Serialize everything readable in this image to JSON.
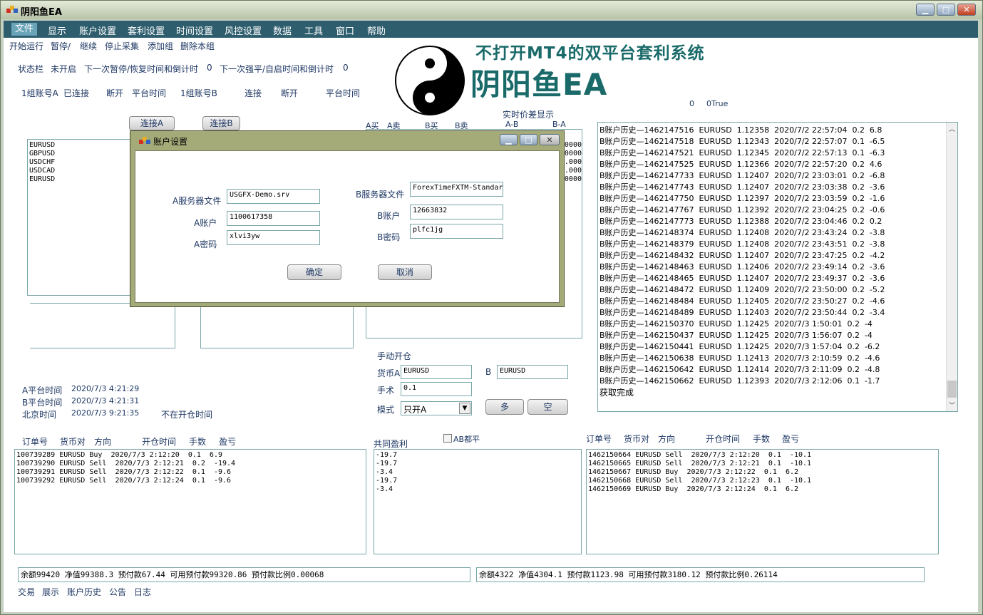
{
  "window": {
    "title": "阴阳鱼EA",
    "min": "▁",
    "max": "□",
    "close": "✕"
  },
  "menu": [
    "文件",
    "显示",
    "账户设置",
    "套利设置",
    "时间设置",
    "风控设置",
    "数据",
    "工具",
    "窗口",
    "帮助"
  ],
  "toolbar": [
    "开始运行",
    "暂停/",
    "继续",
    "停止采集",
    "添加组",
    "删除本组"
  ],
  "status_line": [
    "状态栏",
    "未开启",
    "下一次暂停/恢复时间和倒计时",
    "0",
    "下一次强平/自启时间和倒计时",
    "0"
  ],
  "group_line": [
    "1组账号A",
    "已连接",
    "断开",
    "平台时间",
    "1组账号B",
    "连接",
    "断开",
    "平台时间"
  ],
  "banner": {
    "line1": "不打开MT4的双平台套利系统",
    "line2": "阴阳鱼EA"
  },
  "top_right_status": [
    "0",
    "0True"
  ],
  "connect_a": "连接A",
  "connect_b": "连接B",
  "price_panel": {
    "title": "实时价差显示",
    "headers": [
      "A买",
      "A卖",
      "B买",
      "B卖",
      "A-B",
      "B-A"
    ],
    "values": [
      "0000",
      ".0000",
      ".000",
      ".000",
      "0000",
      "0000"
    ]
  },
  "symbols": [
    "EURUSD",
    "GBPUSD",
    "USDCHF",
    "USDCAD",
    "EURUSD"
  ],
  "history": [
    "B账户历史—1462147516  EURUSD  1.12358  2020/7/2 22:57:04  0.2  6.8",
    "B账户历史—1462147518  EURUSD  1.12343  2020/7/2 22:57:07  0.1  -6.5",
    "B账户历史—1462147521  EURUSD  1.12345  2020/7/2 22:57:13  0.1  -6.3",
    "B账户历史—1462147525  EURUSD  1.12366  2020/7/2 22:57:20  0.2  4.6",
    "B账户历史—1462147733  EURUSD  1.12407  2020/7/2 23:03:01  0.2  -6.8",
    "B账户历史—1462147743  EURUSD  1.12407  2020/7/2 23:03:38  0.2  -3.6",
    "B账户历史—1462147750  EURUSD  1.12397  2020/7/2 23:03:59  0.2  -1.6",
    "B账户历史—1462147767  EURUSD  1.12392  2020/7/2 23:04:25  0.2  -0.6",
    "B账户历史—1462147773  EURUSD  1.12388  2020/7/2 23:04:46  0.2  0.2",
    "B账户历史—1462148374  EURUSD  1.12408  2020/7/2 23:43:24  0.2  -3.8",
    "B账户历史—1462148379  EURUSD  1.12408  2020/7/2 23:43:51  0.2  -3.8",
    "B账户历史—1462148432  EURUSD  1.12407  2020/7/2 23:47:25  0.2  -4.2",
    "B账户历史—1462148463  EURUSD  1.12406  2020/7/2 23:49:14  0.2  -3.6",
    "B账户历史—1462148465  EURUSD  1.12407  2020/7/2 23:49:37  0.2  -3.6",
    "B账户历史—1462148472  EURUSD  1.12409  2020/7/2 23:50:00  0.2  -5.2",
    "B账户历史—1462148484  EURUSD  1.12405  2020/7/2 23:50:27  0.2  -4.6",
    "B账户历史—1462148489  EURUSD  1.12403  2020/7/2 23:50:44  0.2  -3.4",
    "B账户历史—1462150370  EURUSD  1.12425  2020/7/3 1:50:01  0.2  -4",
    "B账户历史—1462150437  EURUSD  1.12425  2020/7/3 1:56:07  0.2  -4",
    "B账户历史—1462150441  EURUSD  1.12425  2020/7/3 1:57:04  0.2  -6.2",
    "B账户历史—1462150638  EURUSD  1.12413  2020/7/3 2:10:59  0.2  -4.6",
    "B账户历史—1462150642  EURUSD  1.12414  2020/7/3 2:11:09  0.2  -4.8",
    "B账户历史—1462150662  EURUSD  1.12393  2020/7/3 2:12:06  0.1  -1.7",
    "获取完成"
  ],
  "times": {
    "a_label": "A平台时间",
    "a_value": "2020/7/3 4:21:29",
    "b_label": "B平台时间",
    "b_value": "2020/7/3 4:21:31",
    "bj_label": "北京时间",
    "bj_value": "2020/7/3 9:21:35",
    "note": "不在开仓时间"
  },
  "manual": {
    "title": "手动开仓",
    "pair_a_label": "货币A",
    "pair_a": "EURUSD",
    "pair_b_label": "B",
    "pair_b": "EURUSD",
    "lots_label": "手术",
    "lots": "0.1",
    "mode_label": "模式",
    "mode": "只开A",
    "long": "多",
    "short": "空"
  },
  "orders_header": [
    "订单号",
    "货币对",
    "方向",
    "开仓时间",
    "手数",
    "盈亏"
  ],
  "orders_a": [
    "100739289 EURUSD Buy  2020/7/3 2:12:20  0.1  6.9",
    "100739290 EURUSD Sell  2020/7/3 2:12:21  0.2  -19.4",
    "100739291 EURUSD Sell  2020/7/3 2:12:22  0.1  -9.6",
    "100739292 EURUSD Sell  2020/7/3 2:12:24  0.1  -9.6"
  ],
  "common": {
    "label": "共同盈利",
    "ab_close": "AB都平",
    "values": [
      "-19.7",
      "-19.7",
      "-3.4",
      "-19.7",
      "-3.4"
    ]
  },
  "orders_b": [
    "1462150664 EURUSD Sell  2020/7/3 2:12:20  0.1  -10.1",
    "1462150665 EURUSD Sell  2020/7/3 2:12:21  0.1  -10.1",
    "1462150667 EURUSD Buy  2020/7/3 2:12:22  0.1  6.2",
    "1462150668 EURUSD Sell  2020/7/3 2:12:23  0.1  -10.1",
    "1462150669 EURUSD Buy  2020/7/3 2:12:24  0.1  6.2"
  ],
  "balance_a": "余额99420  净值99388.3  预付款67.44  可用预付款99320.86  预付款比例0.00068",
  "balance_b": "余额4322  净值4304.1  预付款1123.98  可用预付款3180.12  预付款比例0.26114",
  "bottom_tabs": [
    "交易",
    "展示",
    "账户历史",
    "公告",
    "日志"
  ],
  "dialog": {
    "title": "账户设置",
    "a_server_label": "A服务器文件",
    "a_server": "USGFX-Demo.srv",
    "a_account_label": "A账户",
    "a_account": "1100617358",
    "a_password_label": "A密码",
    "a_password": "xlvi3yw",
    "b_server_label": "B服务器文件",
    "b_server": "ForexTimeFXTM-Standar",
    "b_account_label": "B账户",
    "b_account": "12663832",
    "b_password_label": "B密码",
    "b_password": "plfc1jg",
    "ok": "确定",
    "cancel": "取消"
  },
  "colors": {
    "menubar": "#2e5e6e",
    "accent": "#1f3864",
    "banner": "#1a6a6a",
    "dialog_frame": "#a4aa78"
  }
}
